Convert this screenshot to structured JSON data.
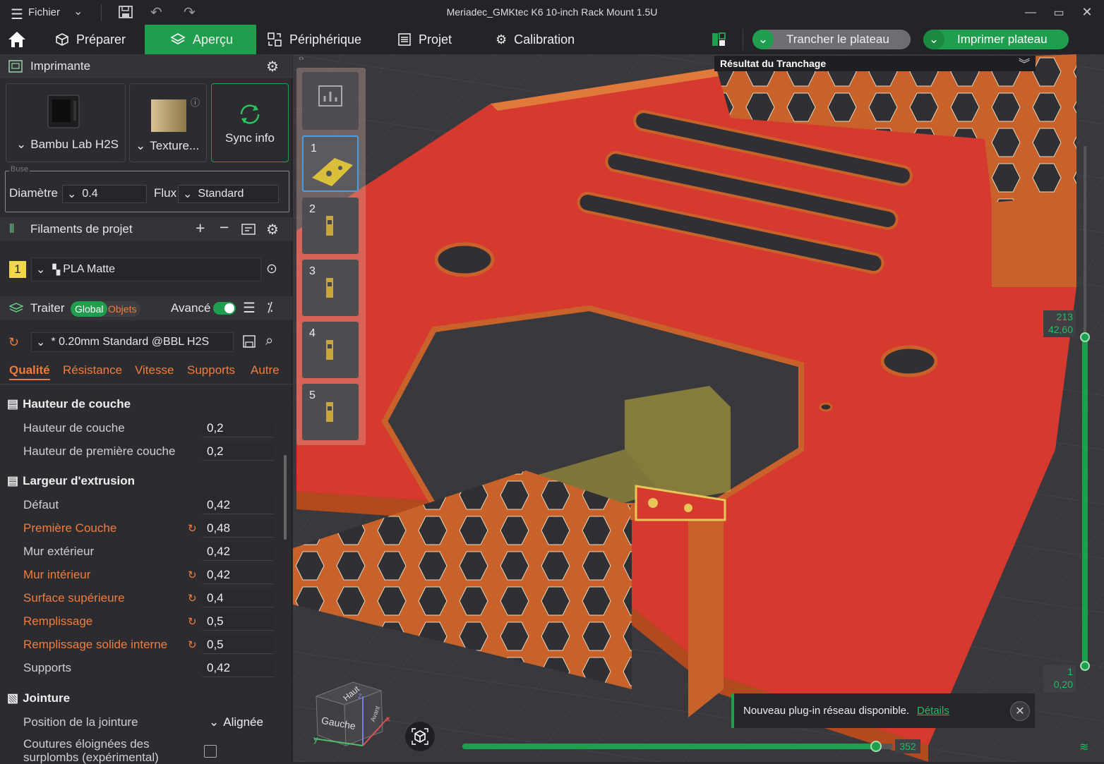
{
  "titlebar": {
    "menu_label": "Fichier",
    "window_title": "Meriadec_GMKtec K6 10-inch Rack Mount 1.5U"
  },
  "nav": {
    "tabs": [
      "Préparer",
      "Aperçu",
      "Périphérique",
      "Projet",
      "Calibration"
    ],
    "active_tab": "Aperçu",
    "slice_button": "Trancher le plateau",
    "print_button": "Imprimer plateau"
  },
  "printer": {
    "section_title": "Imprimante",
    "printer_name": "Bambu Lab H2S",
    "plate_name": "Texture...",
    "sync_label": "Sync info",
    "nozzle_group": "Buse",
    "diameter_label": "Diamètre",
    "diameter_value": "0.4",
    "flow_label": "Flux",
    "flow_value": "Standard"
  },
  "filaments": {
    "section_title": "Filaments de projet",
    "items": [
      {
        "index": "1",
        "name": "PLA Matte",
        "color": "#f3d74a"
      }
    ]
  },
  "process": {
    "section_title": "Traiter",
    "toggle_global": "Global",
    "toggle_objects": "Objets",
    "advanced_label": "Avancé",
    "advanced_on": true,
    "profile": "* 0.20mm Standard @BBL H2S",
    "tabs": [
      "Qualité",
      "Résistance",
      "Vitesse",
      "Supports",
      "Autre"
    ],
    "active_tab": "Qualité"
  },
  "settings": {
    "layer_height": {
      "title": "Hauteur de couche",
      "rows": [
        {
          "label": "Hauteur de couche",
          "value": "0,2",
          "modified": false
        },
        {
          "label": "Hauteur de première couche",
          "value": "0,2",
          "modified": false
        }
      ]
    },
    "line_width": {
      "title": "Largeur d'extrusion",
      "rows": [
        {
          "label": "Défaut",
          "value": "0,42",
          "modified": false
        },
        {
          "label": "Première Couche",
          "value": "0,48",
          "modified": true
        },
        {
          "label": "Mur extérieur",
          "value": "0,42",
          "modified": false
        },
        {
          "label": "Mur intérieur",
          "value": "0,42",
          "modified": true
        },
        {
          "label": "Surface supérieure",
          "value": "0,4",
          "modified": true
        },
        {
          "label": "Remplissage",
          "value": "0,5",
          "modified": true
        },
        {
          "label": "Remplissage solide interne",
          "value": "0,5",
          "modified": true
        },
        {
          "label": "Supports",
          "value": "0,42",
          "modified": false
        }
      ]
    },
    "seam": {
      "title": "Jointure",
      "position_label": "Position de la jointure",
      "position_value": "Alignée",
      "overhang_label_line1": "Coutures éloignées des",
      "overhang_label_line2": "surplombs (expérimental)",
      "overhang_checked": false
    }
  },
  "preview": {
    "slice_result_title": "Résultat du Tranchage",
    "plates": [
      "1",
      "2",
      "3",
      "4",
      "5"
    ],
    "selected_plate": "1",
    "layer_slider": {
      "top_layer": "213",
      "top_height": "42,60",
      "bottom_layer": "1",
      "bottom_height": "0,20"
    },
    "move_slider": {
      "value": "352",
      "fraction": 0.96
    },
    "view_cube": {
      "top": "Haut",
      "left": "Gauche",
      "front": "Avant"
    },
    "axes": {
      "y": "y",
      "z": "z",
      "x": "x"
    },
    "notification": {
      "text": "Nouveau plug-in réseau disponible.",
      "link": "Détails"
    }
  },
  "colors": {
    "accent": "#1f9e4d",
    "modified": "#f07c3c",
    "model_top": "#d63a2e",
    "model_wall": "#c8622a",
    "background": "#38383d"
  }
}
